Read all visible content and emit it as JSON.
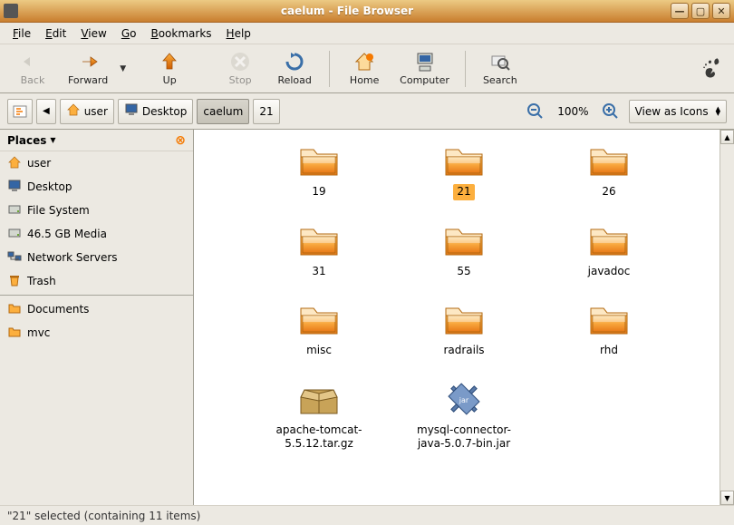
{
  "window": {
    "title": "caelum - File Browser"
  },
  "menu": {
    "file": "File",
    "edit": "Edit",
    "view": "View",
    "go": "Go",
    "bookmarks": "Bookmarks",
    "help": "Help"
  },
  "toolbar": {
    "back": "Back",
    "forward": "Forward",
    "up": "Up",
    "stop": "Stop",
    "reload": "Reload",
    "home": "Home",
    "computer": "Computer",
    "search": "Search"
  },
  "location": {
    "back_small": "◀",
    "segments": [
      {
        "label": "user",
        "icon": "home"
      },
      {
        "label": "Desktop",
        "icon": "desktop"
      },
      {
        "label": "caelum",
        "icon": null
      },
      {
        "label": "21",
        "icon": null
      }
    ],
    "active_segment": 2,
    "zoom": "100%",
    "view_mode": "View as Icons"
  },
  "sidebar": {
    "header": "Places",
    "items": [
      {
        "label": "user",
        "icon": "home"
      },
      {
        "label": "Desktop",
        "icon": "desktop"
      },
      {
        "label": "File System",
        "icon": "disk"
      },
      {
        "label": "46.5 GB Media",
        "icon": "disk"
      },
      {
        "label": "Network Servers",
        "icon": "network"
      },
      {
        "label": "Trash",
        "icon": "trash"
      }
    ],
    "bookmarks": [
      {
        "label": "Documents",
        "icon": "folder"
      },
      {
        "label": "mvc",
        "icon": "folder"
      }
    ]
  },
  "files": [
    {
      "name": "19",
      "type": "folder"
    },
    {
      "name": "21",
      "type": "folder",
      "selected": true
    },
    {
      "name": "26",
      "type": "folder"
    },
    {
      "name": "31",
      "type": "folder"
    },
    {
      "name": "55",
      "type": "folder"
    },
    {
      "name": "javadoc",
      "type": "folder"
    },
    {
      "name": "misc",
      "type": "folder"
    },
    {
      "name": "radrails",
      "type": "folder"
    },
    {
      "name": "rhd",
      "type": "folder"
    },
    {
      "name": "apache-tomcat-5.5.12.tar.gz",
      "type": "archive"
    },
    {
      "name": "mysql-connector-java-5.0.7-bin.jar",
      "type": "jar"
    }
  ],
  "status": "\"21\" selected (containing 11 items)"
}
